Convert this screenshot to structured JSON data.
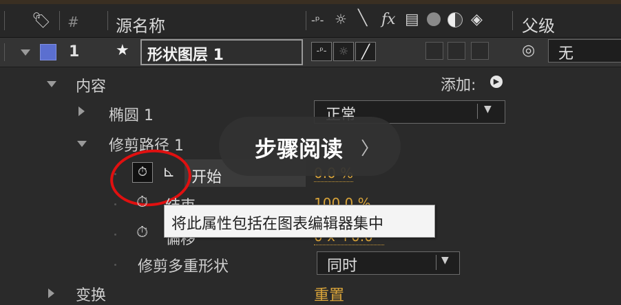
{
  "header": {
    "hash": "#",
    "source_name": "源名称",
    "parent": "父级",
    "fx": "fx"
  },
  "layer": {
    "number": "1",
    "name": "形状图层 1",
    "parent_value": "无",
    "color": "#5b6fd0"
  },
  "contents": {
    "label": "内容",
    "add_label": "添加:"
  },
  "ellipse": {
    "label": "椭圆 1",
    "blend_mode": "正常"
  },
  "trim": {
    "label": "修剪路径 1",
    "start_label": "开始",
    "start_value": "0.0 %",
    "end_label": "结束",
    "end_value": "100.0 %",
    "offset_label": "偏移",
    "offset_value": "0 x +0.0 °",
    "multiple_label": "修剪多重形状",
    "multiple_value": "同时"
  },
  "transform": {
    "label": "变换",
    "reset_label": "重置"
  },
  "tooltip": {
    "text": "将此属性包括在图表编辑器集中"
  },
  "overlay": {
    "text": "步骤阅读",
    "arrow": "〉"
  },
  "colors": {
    "accent": "#d9a43a",
    "highlight_circle": "#e01010",
    "layer_label": "#5b6fd0"
  }
}
